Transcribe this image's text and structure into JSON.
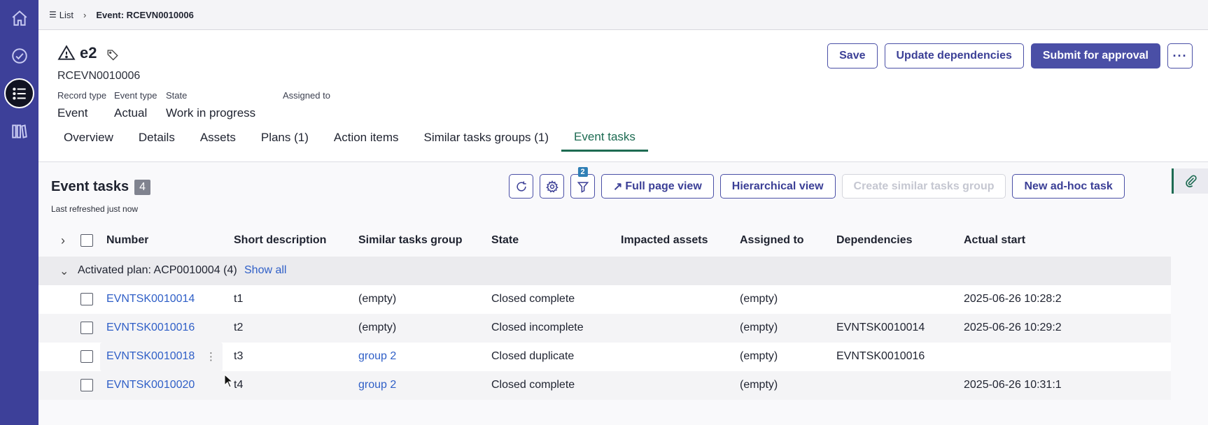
{
  "rail": {
    "items": [
      {
        "icon": "home-icon"
      },
      {
        "icon": "check-circle-icon"
      },
      {
        "icon": "list-icon",
        "active": true
      },
      {
        "icon": "library-icon"
      }
    ]
  },
  "breadcrumb": {
    "list_label": "List",
    "current": "Event: RCEVN0010006"
  },
  "header": {
    "title": "e2",
    "number": "RCEVN0010006",
    "fields": [
      {
        "label": "Record type",
        "value": "Event"
      },
      {
        "label": "Event type",
        "value": "Actual"
      },
      {
        "label": "State",
        "value": "Work in progress"
      },
      {
        "label": "Assigned to",
        "value": ""
      }
    ],
    "actions": {
      "save": "Save",
      "update_dependencies": "Update dependencies",
      "submit": "Submit for approval",
      "more": "···"
    }
  },
  "tabs": [
    {
      "label": "Overview"
    },
    {
      "label": "Details"
    },
    {
      "label": "Assets"
    },
    {
      "label": "Plans (1)"
    },
    {
      "label": "Action items"
    },
    {
      "label": "Similar tasks groups (1)"
    },
    {
      "label": "Event tasks",
      "active": true
    }
  ],
  "panel": {
    "title": "Event tasks",
    "count": "4",
    "refreshed": "Last refreshed just now",
    "filter_count": "2",
    "buttons": {
      "full_page": "Full page view",
      "hierarchical": "Hierarchical view",
      "create_group": "Create similar tasks group",
      "new_adhoc": "New ad-hoc task"
    }
  },
  "table": {
    "columns": [
      "Number",
      "Short description",
      "Similar tasks group",
      "State",
      "Impacted assets",
      "Assigned to",
      "Dependencies",
      "Actual start"
    ],
    "group": {
      "label": "Activated plan: ACP0010004 (4)",
      "show_all": "Show all"
    },
    "rows": [
      {
        "number": "EVNTSK0010014",
        "short": "t1",
        "group": "(empty)",
        "group_link": false,
        "state": "Closed complete",
        "impacted": "",
        "assigned": "(empty)",
        "deps": "",
        "start": "2025-06-26 10:28:2"
      },
      {
        "number": "EVNTSK0010016",
        "short": "t2",
        "group": "(empty)",
        "group_link": false,
        "state": "Closed incomplete",
        "impacted": "",
        "assigned": "(empty)",
        "deps": "EVNTSK0010014",
        "start": "2025-06-26 10:29:2"
      },
      {
        "number": "EVNTSK0010018",
        "short": "t3",
        "group": "group 2",
        "group_link": true,
        "state": "Closed duplicate",
        "impacted": "",
        "assigned": "(empty)",
        "deps": "EVNTSK0010016",
        "start": ""
      },
      {
        "number": "EVNTSK0010020",
        "short": "t4",
        "group": "group 2",
        "group_link": true,
        "state": "Closed complete",
        "impacted": "",
        "assigned": "(empty)",
        "deps": "",
        "start": "2025-06-26 10:31:1"
      }
    ]
  }
}
